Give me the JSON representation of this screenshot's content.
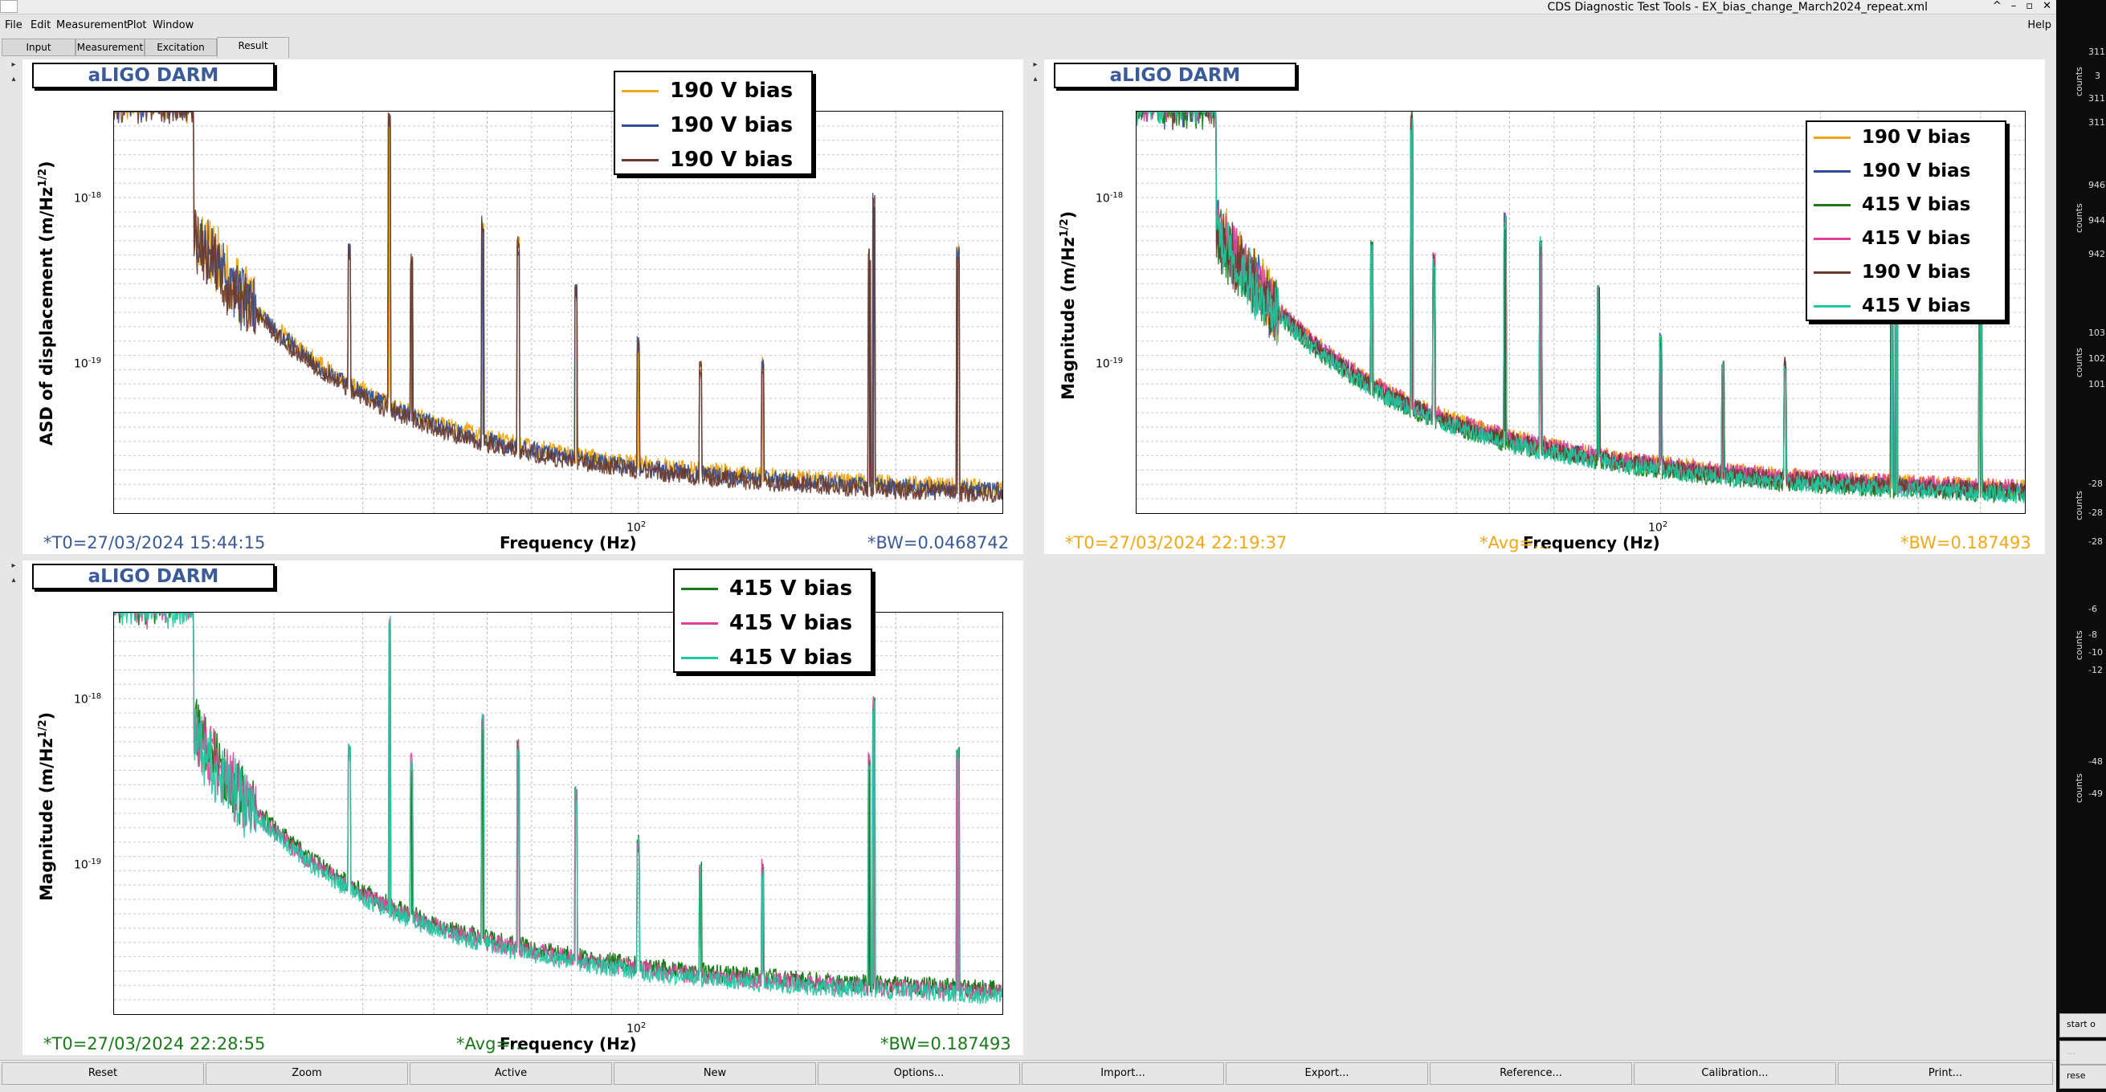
{
  "window": {
    "title": "CDS Diagnostic Test Tools - EX_bias_change_March2024_repeat.xml",
    "controls": [
      "^",
      "–",
      "▫",
      "✕"
    ]
  },
  "menu": {
    "items": [
      "File",
      "Edit",
      "Measurement",
      "Plot",
      "Window"
    ],
    "help": "Help"
  },
  "tabs": [
    "Input",
    "Measurement",
    "Excitation",
    "Result"
  ],
  "active_tab": "Result",
  "panels": [
    {
      "id": "top-left",
      "title_box": "aLIGO DARM",
      "ylabel": "ASD of displacement (m/Hz^1/2)",
      "ylabel_base": "ASD of displacement (m/Hz",
      "ylabel_exp": "1/2",
      "xlabel": "Frequency (Hz)",
      "x_tick_label": "10^2",
      "y_tick_labels": [
        "10^-18",
        "10^-19"
      ],
      "t0": "*T0=27/03/2024 15:44:15",
      "avg": "",
      "bw": "*BW=0.0468742",
      "info_color": "#3b5a98",
      "legend": [
        {
          "label": "190 V bias",
          "color": "#f0a818"
        },
        {
          "label": "190 V bias",
          "color": "#2e4d9a"
        },
        {
          "label": "190 V bias",
          "color": "#6b3a2a"
        }
      ]
    },
    {
      "id": "top-right",
      "title_box": "aLIGO DARM",
      "ylabel": "Magnitude (m/Hz^1/2)",
      "ylabel_base": "Magnitude (m/Hz",
      "ylabel_exp": "1/2",
      "xlabel": "Frequency (Hz)",
      "x_tick_label": "10^2",
      "y_tick_labels": [
        "10^-18",
        "10^-19"
      ],
      "t0": "*T0=27/03/2024 22:19:37",
      "avg": "*Avg=…",
      "bw": "*BW=0.187493",
      "info_color": "#f0a818",
      "legend": [
        {
          "label": "190 V bias",
          "color": "#f0a818"
        },
        {
          "label": "190 V bias",
          "color": "#2e4d9a"
        },
        {
          "label": "415 V bias",
          "color": "#1a7a1a"
        },
        {
          "label": "415 V bias",
          "color": "#e0409a"
        },
        {
          "label": "190 V bias",
          "color": "#6b3a2a"
        },
        {
          "label": "415 V bias",
          "color": "#20c8a0"
        }
      ]
    },
    {
      "id": "bottom-left",
      "title_box": "aLIGO DARM",
      "ylabel": "Magnitude (m/Hz^1/2)",
      "ylabel_base": "Magnitude (m/Hz",
      "ylabel_exp": "1/2",
      "xlabel": "Frequency (Hz)",
      "x_tick_label": "10^2",
      "y_tick_labels": [
        "10^-18",
        "10^-19"
      ],
      "t0": "*T0=27/03/2024 22:28:55",
      "avg": "*Avg=…",
      "bw": "*BW=0.187493",
      "info_color": "#1a7a1a",
      "legend": [
        {
          "label": "415 V bias",
          "color": "#1a7a1a"
        },
        {
          "label": "415 V bias",
          "color": "#e0409a"
        },
        {
          "label": "415 V bias",
          "color": "#20c8a0"
        }
      ]
    }
  ],
  "bottom_buttons": [
    "Reset",
    "Zoom",
    "Active",
    "New",
    "Options...",
    "Import...",
    "Export...",
    "Reference...",
    "Calibration...",
    "Print..."
  ],
  "right_strip": {
    "labels": [
      "311",
      "3",
      "311",
      "311",
      "946",
      "944",
      "942",
      "103",
      "102",
      "101",
      "-28",
      "-28",
      "-28",
      "-6",
      "-8",
      "-10",
      "-12",
      "-48",
      "-49"
    ],
    "axis_label": "counts",
    "buttons": [
      "start o",
      "...",
      "rese"
    ]
  }
}
